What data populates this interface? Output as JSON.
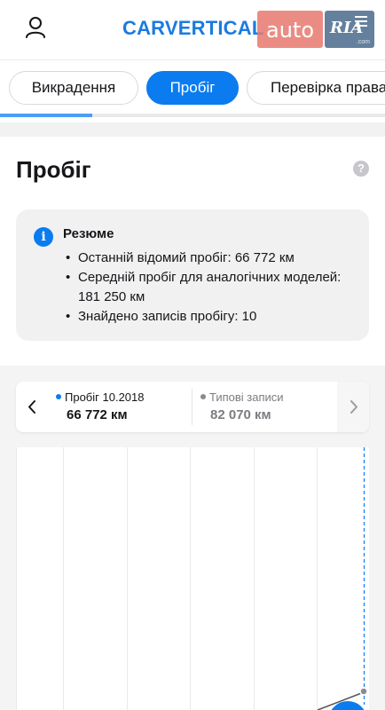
{
  "header": {
    "logo": "CARVERTICAL",
    "badge_auto": "auto",
    "badge_ria": "RIA",
    "badge_ria_domain": ".com"
  },
  "tabs": [
    {
      "label": "Викрадення",
      "active": false
    },
    {
      "label": "Пробіг",
      "active": true
    },
    {
      "label": "Перевірка права",
      "active": false
    }
  ],
  "section": {
    "title": "Пробіг",
    "help": "?"
  },
  "summary": {
    "title": "Резюме",
    "items": [
      "Останній відомий пробіг: 66 772 км",
      "Середній пробіг для аналогічних моделей: 181 250 км",
      "Знайдено записів пробігу: 10"
    ]
  },
  "legend": {
    "primary_label": "Пробіг 10.2018",
    "primary_value": "66 772 км",
    "secondary_label": "Типові записи",
    "secondary_value": "82 070 км"
  },
  "colors": {
    "accent": "#0a7cf0",
    "muted": "#8a8a90"
  },
  "icons": [
    "user-icon",
    "info-icon",
    "help-icon",
    "chevron-left-icon",
    "chevron-right-icon"
  ]
}
